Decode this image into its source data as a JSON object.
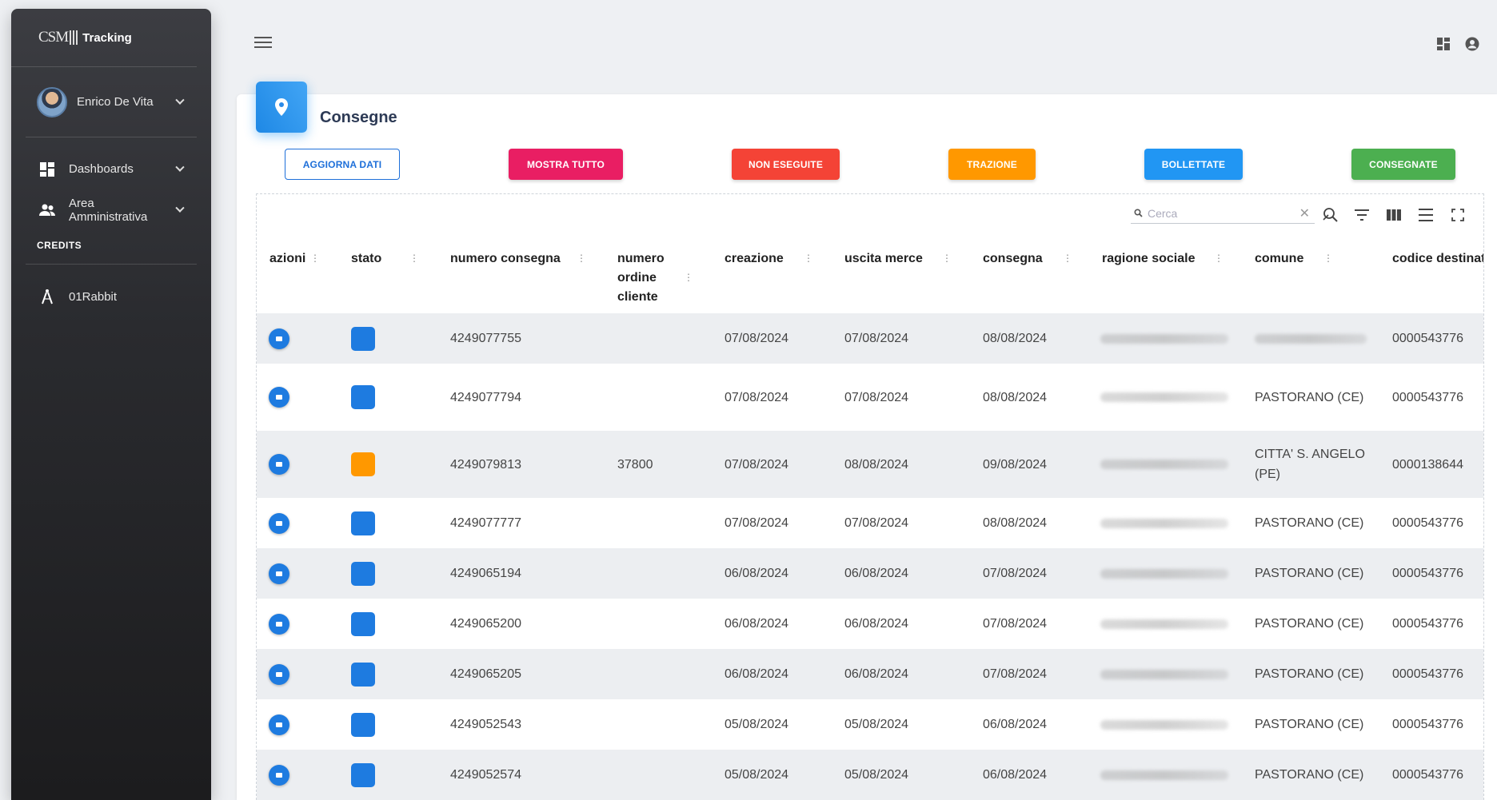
{
  "app": {
    "logo_text": "CSM",
    "title": "Tracking"
  },
  "user": {
    "name": "Enrico De Vita"
  },
  "sidebar": {
    "items": [
      {
        "label": "Dashboards",
        "icon": "dashboard-icon"
      },
      {
        "label": "Area Amministrativa",
        "icon": "people-icon"
      }
    ],
    "credits_label": "CREDITS",
    "credits_item": {
      "label": "01Rabbit",
      "icon": "compass-icon"
    }
  },
  "page": {
    "title": "Consegne",
    "icon": "location-pin-icon"
  },
  "buttons": {
    "refresh": "AGGIORNA DATI",
    "show_all": "MOSTRA TUTTO",
    "not_executed": "NON ESEGUITE",
    "traction": "TRAZIONE",
    "billed": "BOLLETTATE",
    "delivered": "CONSEGNATE"
  },
  "colors": {
    "blue": "#1e7be0",
    "pink": "#e91e63",
    "red": "#f44336",
    "orange": "#ff9800",
    "light_blue": "#2196f3",
    "green": "#4caf50"
  },
  "search": {
    "placeholder": "Cerca"
  },
  "table": {
    "headers": {
      "azioni": "azioni",
      "stato": "stato",
      "numero_consegna": "numero consegna",
      "numero_ordine_1": "numero",
      "numero_ordine_2": "ordine",
      "numero_ordine_3": "cliente",
      "creazione": "creazione",
      "uscita_merce": "uscita merce",
      "consegna": "consegna",
      "ragione_sociale": "ragione sociale",
      "comune": "comune",
      "codice_destinatario": "codice destinat"
    },
    "rows": [
      {
        "state": "blue",
        "numero": "4249077755",
        "ordine": "",
        "creazione": "07/08/2024",
        "uscita": "07/08/2024",
        "consegna": "08/08/2024",
        "comune": "",
        "codice": "0000543776"
      },
      {
        "state": "blue",
        "numero": "4249077794",
        "ordine": "",
        "creazione": "07/08/2024",
        "uscita": "07/08/2024",
        "consegna": "08/08/2024",
        "comune": "PASTORANO (CE)",
        "codice": "0000543776"
      },
      {
        "state": "orange",
        "numero": "4249079813",
        "ordine": "37800",
        "creazione": "07/08/2024",
        "uscita": "08/08/2024",
        "consegna": "09/08/2024",
        "comune": "CITTA' S. ANGELO",
        "comune_2": "(PE)",
        "codice": "0000138644"
      },
      {
        "state": "blue",
        "numero": "4249077777",
        "ordine": "",
        "creazione": "07/08/2024",
        "uscita": "07/08/2024",
        "consegna": "08/08/2024",
        "comune": "PASTORANO (CE)",
        "codice": "0000543776"
      },
      {
        "state": "blue",
        "numero": "4249065194",
        "ordine": "",
        "creazione": "06/08/2024",
        "uscita": "06/08/2024",
        "consegna": "07/08/2024",
        "comune": "PASTORANO (CE)",
        "codice": "0000543776"
      },
      {
        "state": "blue",
        "numero": "4249065200",
        "ordine": "",
        "creazione": "06/08/2024",
        "uscita": "06/08/2024",
        "consegna": "07/08/2024",
        "comune": "PASTORANO (CE)",
        "codice": "0000543776"
      },
      {
        "state": "blue",
        "numero": "4249065205",
        "ordine": "",
        "creazione": "06/08/2024",
        "uscita": "06/08/2024",
        "consegna": "07/08/2024",
        "comune": "PASTORANO (CE)",
        "codice": "0000543776"
      },
      {
        "state": "blue",
        "numero": "4249052543",
        "ordine": "",
        "creazione": "05/08/2024",
        "uscita": "05/08/2024",
        "consegna": "06/08/2024",
        "comune": "PASTORANO (CE)",
        "codice": "0000543776"
      },
      {
        "state": "blue",
        "numero": "4249052574",
        "ordine": "",
        "creazione": "05/08/2024",
        "uscita": "05/08/2024",
        "consegna": "06/08/2024",
        "comune": "PASTORANO (CE)",
        "codice": "0000543776"
      }
    ]
  }
}
